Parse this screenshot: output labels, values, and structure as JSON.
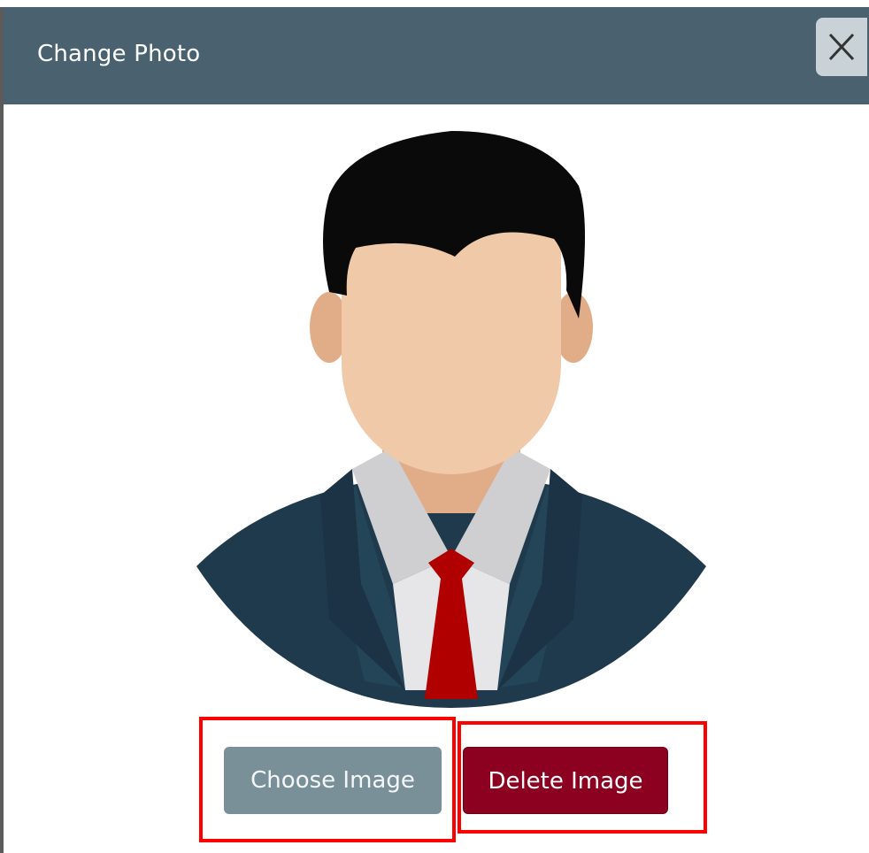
{
  "dialog": {
    "title": "Change Photo",
    "close_icon": "close-icon",
    "header_color": "#4a6270"
  },
  "avatar": {
    "icon": "user-avatar-icon",
    "tie_color": "#b00000",
    "suit_color": "#1f3a4d"
  },
  "actions": {
    "choose_label": "Choose Image",
    "delete_label": "Delete Image",
    "choose_color": "#7a9099",
    "delete_color": "#8c0020",
    "highlight_color": "#ff0000"
  }
}
